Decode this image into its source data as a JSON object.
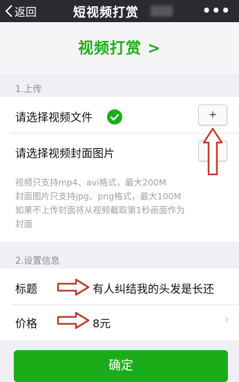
{
  "nav": {
    "back_label": "返回",
    "title": "短视频打赏",
    "more_label": "•••"
  },
  "header": {
    "title": "视频打赏 >"
  },
  "upload": {
    "section_label": "1.上传",
    "video_label": "请选择视频文件",
    "cover_label": "请选择视频封面图片",
    "add_label": "+",
    "hints": [
      "视频只支持mp4、avi格式，最大200M",
      "封面图片只支持jpg、png格式，最大100M",
      "如果不上传封面将从视频截取第1秒画面作为",
      "封面"
    ]
  },
  "settings": {
    "section_label": "2.设置信息",
    "title_label": "标题",
    "title_value": "有人纠结我的头发是长还",
    "price_label": "价格",
    "price_value": "8元"
  },
  "confirm_label": "确定",
  "colors": {
    "accent": "#1aad19",
    "arrow": "#c0392b"
  }
}
